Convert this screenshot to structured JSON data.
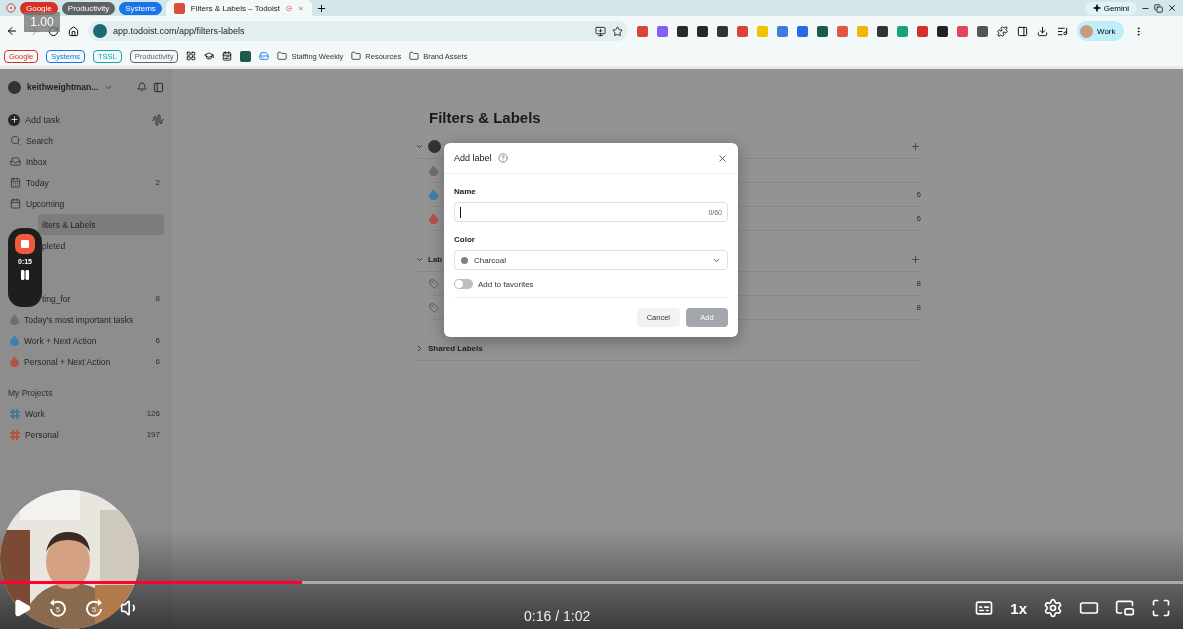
{
  "video_overlay": {
    "speed_badge": "1.00",
    "recorder_time": "0:15"
  },
  "browser": {
    "tab_groups": [
      {
        "label": "Google",
        "color": "#d93025"
      },
      {
        "label": "Productivity",
        "color": "#5f6368"
      },
      {
        "label": "Systems",
        "color": "#1a73e8"
      }
    ],
    "active_tab": {
      "title": "Filters & Labels – Todoist"
    },
    "gemini": "Gemini",
    "url": "app.todoist.com/app/filters-labels",
    "profile": "Work",
    "bookmark_groups": [
      {
        "label": "Google",
        "color": "#d93025"
      },
      {
        "label": "Systems",
        "color": "#1a73e8"
      },
      {
        "label": "TSSL",
        "color": "#12a4af"
      },
      {
        "label": "Productivity",
        "color": "#5f6368"
      }
    ],
    "bookmark_folders": [
      "Staffing Weekly",
      "Resources",
      "Brand Assets"
    ]
  },
  "sidebar": {
    "account": "keithweightman...",
    "add_task": "Add task",
    "nav": [
      {
        "kind": "search",
        "label": "Search",
        "selected": false,
        "partial": false
      },
      {
        "kind": "inbox",
        "label": "Inbox",
        "selected": false,
        "partial": false
      },
      {
        "kind": "today",
        "label": "Today",
        "count": "2",
        "selected": false,
        "partial": false
      },
      {
        "kind": "upcoming",
        "label": "Upcoming",
        "selected": false,
        "partial": false
      },
      {
        "label": "ilters & Labels",
        "selected": true,
        "partial": true
      },
      {
        "label": "pleted",
        "selected": false,
        "partial": true
      }
    ],
    "filters": [
      {
        "label": "ting_for",
        "count": "8",
        "partial": true
      },
      {
        "label": "Today's most important tasks",
        "partial": false,
        "color": "#6f6f6f"
      },
      {
        "label": "Work + Next Action",
        "count": "6",
        "partial": false,
        "color": "#3f7fae"
      },
      {
        "label": "Personal + Next Action",
        "count": "6",
        "partial": false,
        "color": "#b5504a"
      }
    ],
    "projects_heading": "My Projects",
    "projects": [
      {
        "label": "Work",
        "count": "126",
        "color": "#3f7f8f"
      },
      {
        "label": "Personal",
        "count": "197",
        "color": "#b5553c"
      }
    ]
  },
  "main": {
    "title": "Filters & Labels",
    "sections": [
      {
        "kind": "filters",
        "expanded": true,
        "rows": [
          {
            "color": "#6f6f6f"
          },
          {
            "color": "#3f7fae",
            "count": "6"
          },
          {
            "color": "#b5504a",
            "count": "6"
          }
        ]
      },
      {
        "kind": "labels",
        "heading": "Lab",
        "expanded": true,
        "rows": [
          {
            "count": "8"
          },
          {
            "count": "8"
          }
        ]
      },
      {
        "kind": "shared",
        "heading": "Shared Labels",
        "expanded": false
      }
    ]
  },
  "dialog": {
    "title": "Add label",
    "name_label": "Name",
    "counter": "0/60",
    "color_label": "Color",
    "color_choice": {
      "label": "Charcoal",
      "color": "#808080"
    },
    "favorite_label": "Add to favorites",
    "favorite_on": false,
    "buttons": [
      {
        "label": "Cancel",
        "kind": "secondary",
        "disabled": false
      },
      {
        "label": "Add",
        "kind": "primary",
        "disabled": true
      }
    ]
  },
  "player": {
    "progress": {
      "level": 0.255
    },
    "playing": false,
    "rewind": "5",
    "forward": "5",
    "time": "0:16 / 1:02",
    "speed": "1x"
  }
}
